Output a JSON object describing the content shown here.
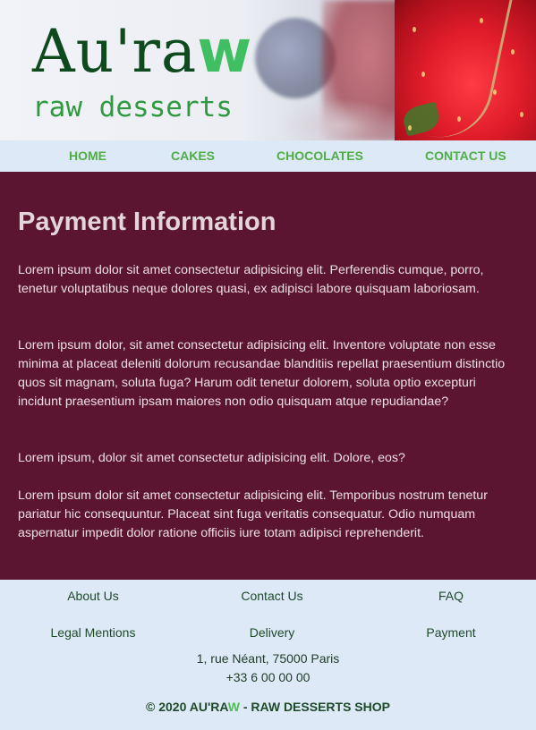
{
  "header": {
    "logo_main": "Au'ra",
    "logo_accent": "w",
    "tagline": "raw desserts"
  },
  "nav": {
    "items": [
      {
        "label": "HOME"
      },
      {
        "label": "CAKES"
      },
      {
        "label": "CHOCOLATES"
      },
      {
        "label": "CONTACT US"
      }
    ]
  },
  "main": {
    "title": "Payment Information",
    "paragraphs": [
      "Lorem ipsum dolor sit amet consectetur adipisicing elit. Perferendis cumque, porro, tenetur voluptatibus neque dolores quasi, ex adipisci labore quisquam laboriosam.",
      "Lorem ipsum dolor, sit amet consectetur adipisicing elit. Inventore voluptate non esse minima at placeat deleniti dolorum recusandae blanditiis repellat praesentium distinctio quos sit magnam, soluta fuga? Harum odit tenetur dolorem, soluta optio excepturi incidunt praesentium ipsam maiores non odio quisquam atque repudiandae?",
      "Lorem ipsum, dolor sit amet consectetur adipisicing elit. Dolore, eos?",
      "Lorem ipsum dolor sit amet consectetur adipisicing elit. Temporibus nostrum tenetur pariatur hic consequuntur. Placeat sint fuga veritatis consequatur. Odio numquam aspernatur impedit dolor ratione officiis iure totam adipisci reprehenderit."
    ]
  },
  "footer": {
    "links": [
      {
        "label": "About Us"
      },
      {
        "label": "Contact Us"
      },
      {
        "label": "FAQ"
      },
      {
        "label": "Legal Mentions"
      },
      {
        "label": "Delivery"
      },
      {
        "label": "Payment"
      }
    ],
    "address": "1, rue Néant, 75000 Paris",
    "phone": "+33 6 00 00 00",
    "copyright_prefix": "© 2020 AU'RA",
    "copyright_accent": "W",
    "copyright_suffix": " - RAW DESSERTS SHOP"
  },
  "colors": {
    "main_bg": "#5c1530",
    "nav_link": "#4fae44",
    "light_bg": "#dde9f7",
    "logo_green": "#0f4a1f",
    "accent_green": "#3fbf62"
  }
}
